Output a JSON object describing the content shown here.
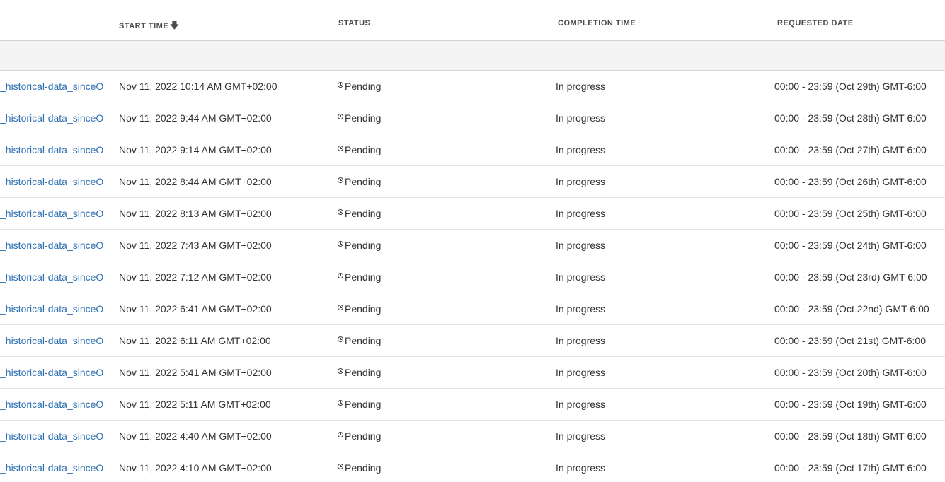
{
  "table": {
    "columns": {
      "start_time": "START TIME",
      "status": "STATUS",
      "completion_time": "COMPLETION TIME",
      "requested_date": "REQUESTED DATE"
    },
    "sort_icon": "arrow-down-icon",
    "rows": [
      {
        "name": "_historical-data_sinceO…",
        "start_time": "Nov 11, 2022 10:14 AM GMT+02:00",
        "status": "Pending",
        "completion_time": "In progress",
        "requested_date": "00:00 - 23:59 (Oct 29th) GMT-6:00"
      },
      {
        "name": "_historical-data_sinceO…",
        "start_time": "Nov 11, 2022 9:44 AM GMT+02:00",
        "status": "Pending",
        "completion_time": "In progress",
        "requested_date": "00:00 - 23:59 (Oct 28th) GMT-6:00"
      },
      {
        "name": "_historical-data_sinceO…",
        "start_time": "Nov 11, 2022 9:14 AM GMT+02:00",
        "status": "Pending",
        "completion_time": "In progress",
        "requested_date": "00:00 - 23:59 (Oct 27th) GMT-6:00"
      },
      {
        "name": "_historical-data_sinceO…",
        "start_time": "Nov 11, 2022 8:44 AM GMT+02:00",
        "status": "Pending",
        "completion_time": "In progress",
        "requested_date": "00:00 - 23:59 (Oct 26th) GMT-6:00"
      },
      {
        "name": "_historical-data_sinceO…",
        "start_time": "Nov 11, 2022 8:13 AM GMT+02:00",
        "status": "Pending",
        "completion_time": "In progress",
        "requested_date": "00:00 - 23:59 (Oct 25th) GMT-6:00"
      },
      {
        "name": "_historical-data_sinceO…",
        "start_time": "Nov 11, 2022 7:43 AM GMT+02:00",
        "status": "Pending",
        "completion_time": "In progress",
        "requested_date": "00:00 - 23:59 (Oct 24th) GMT-6:00"
      },
      {
        "name": "_historical-data_sinceO…",
        "start_time": "Nov 11, 2022 7:12 AM GMT+02:00",
        "status": "Pending",
        "completion_time": "In progress",
        "requested_date": "00:00 - 23:59 (Oct 23rd) GMT-6:00"
      },
      {
        "name": "_historical-data_sinceO…",
        "start_time": "Nov 11, 2022 6:41 AM GMT+02:00",
        "status": "Pending",
        "completion_time": "In progress",
        "requested_date": "00:00 - 23:59 (Oct 22nd) GMT-6:00"
      },
      {
        "name": "_historical-data_sinceO…",
        "start_time": "Nov 11, 2022 6:11 AM GMT+02:00",
        "status": "Pending",
        "completion_time": "In progress",
        "requested_date": "00:00 - 23:59 (Oct 21st) GMT-6:00"
      },
      {
        "name": "_historical-data_sinceO…",
        "start_time": "Nov 11, 2022 5:41 AM GMT+02:00",
        "status": "Pending",
        "completion_time": "In progress",
        "requested_date": "00:00 - 23:59 (Oct 20th) GMT-6:00"
      },
      {
        "name": "_historical-data_sinceO…",
        "start_time": "Nov 11, 2022 5:11 AM GMT+02:00",
        "status": "Pending",
        "completion_time": "In progress",
        "requested_date": "00:00 - 23:59 (Oct 19th) GMT-6:00"
      },
      {
        "name": "_historical-data_sinceO…",
        "start_time": "Nov 11, 2022 4:40 AM GMT+02:00",
        "status": "Pending",
        "completion_time": "In progress",
        "requested_date": "00:00 - 23:59 (Oct 18th) GMT-6:00"
      },
      {
        "name": "_historical-data_sinceO…",
        "start_time": "Nov 11, 2022 4:10 AM GMT+02:00",
        "status": "Pending",
        "completion_time": "In progress",
        "requested_date": "00:00 - 23:59 (Oct 17th) GMT-6:00"
      }
    ]
  }
}
